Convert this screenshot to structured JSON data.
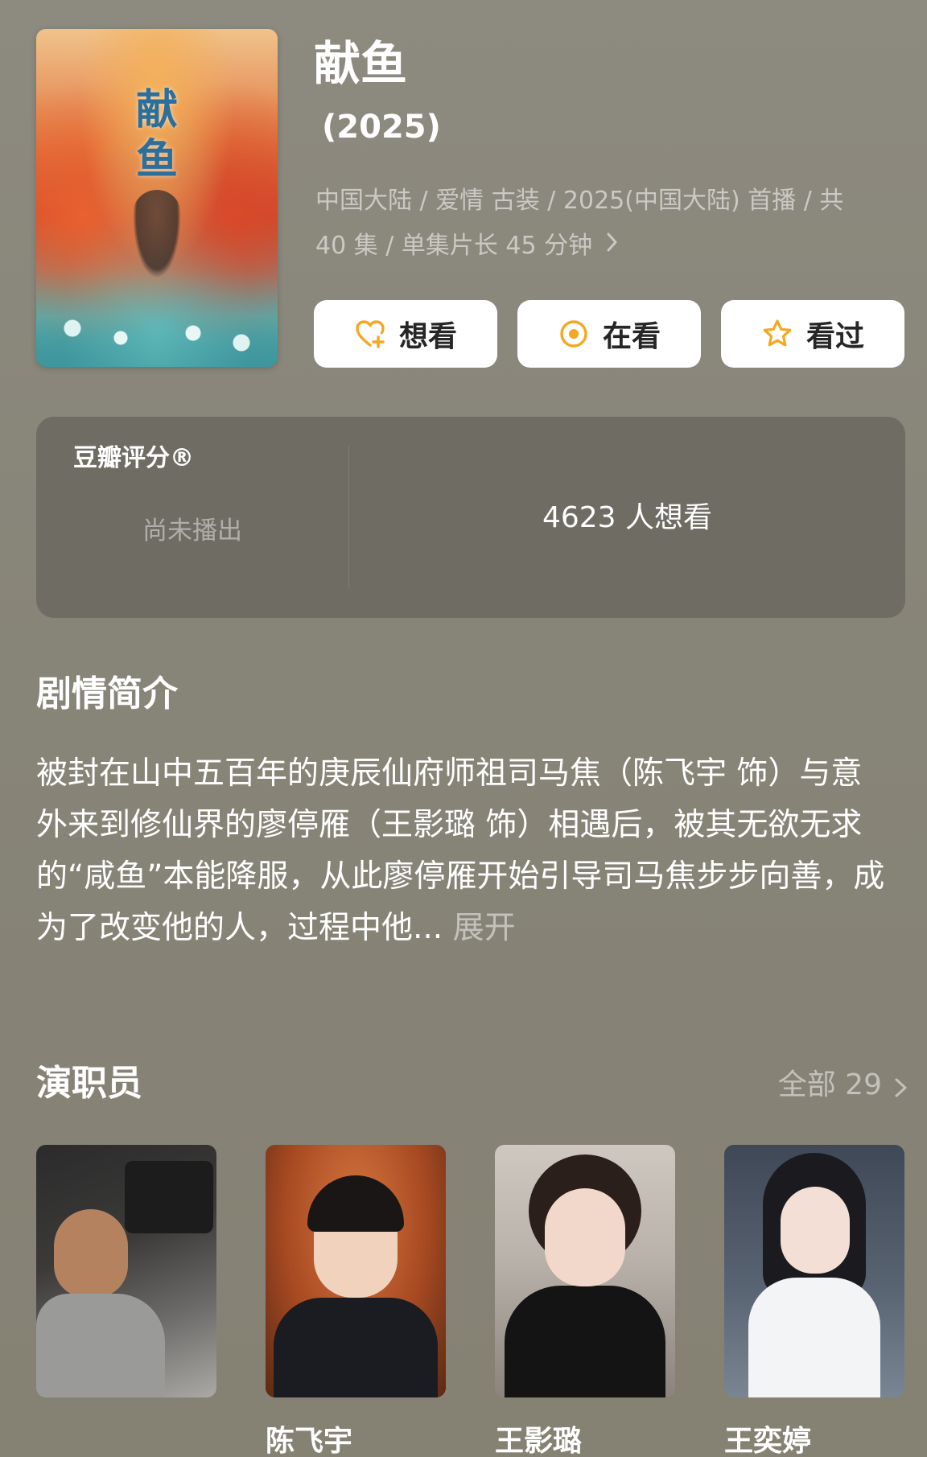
{
  "header": {
    "title": "献鱼",
    "year": "(2025)",
    "meta_line1": "中国大陆 / 爱情 古装 / 2025(中国大陆) 首播 / 共",
    "meta_line2": "40 集 / 单集片长 45 分钟",
    "poster_title": "献鱼"
  },
  "actions": [
    {
      "label": "想看",
      "icon": "heart-plus-icon"
    },
    {
      "label": "在看",
      "icon": "radio-dot-icon"
    },
    {
      "label": "看过",
      "icon": "star-icon"
    }
  ],
  "rating": {
    "label": "豆瓣评分®",
    "value": "尚未播出",
    "want_count": "4623 人想看"
  },
  "synopsis": {
    "title": "剧情简介",
    "text": "被封在山中五百年的庚辰仙府师祖司马焦（陈飞宇 饰）与意外来到修仙界的廖停雁（王影璐 饰）相遇后，被其无欲无求的“咸鱼”本能降服，从此廖停雁开始引导司马焦步步向善，成为了改变他的人，过程中他...",
    "expand": " 展开"
  },
  "cast": {
    "title": "演职员",
    "all_label": "全部 29",
    "members": [
      {
        "name": ""
      },
      {
        "name": "陈飞宇"
      },
      {
        "name": "王影璐"
      },
      {
        "name": "王奕婷"
      }
    ]
  },
  "colors": {
    "background": "#878478",
    "card": "#6f6c64",
    "accent": "#f5a623",
    "button_bg": "#ffffff"
  }
}
